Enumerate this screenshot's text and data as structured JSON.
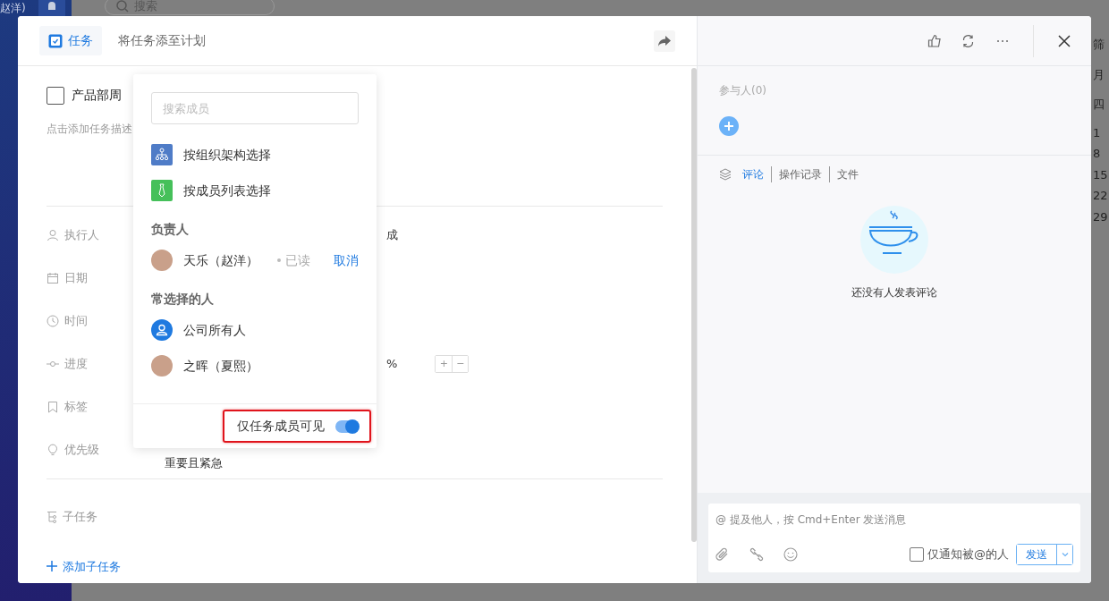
{
  "backdrop": {
    "user_name": "赵洋)",
    "search_placeholder": "搜索",
    "calendar_texts": [
      "筛",
      "月",
      "四",
      "1",
      "8",
      "15",
      "22",
      "29"
    ]
  },
  "task_panel": {
    "tabs": [
      {
        "label": "任务",
        "selected": true
      },
      {
        "label": "将任务添至计划",
        "selected": false
      }
    ],
    "task_title": "产品部周",
    "task_done": false,
    "description_placeholder": "点击添加任务描述",
    "fields": [
      {
        "kind": "person",
        "label": "执行人",
        "value": "成"
      },
      {
        "kind": "date",
        "label": "日期"
      },
      {
        "kind": "time",
        "label": "时间"
      },
      {
        "kind": "progress",
        "label": "进度",
        "value": "%",
        "stepper": [
          "+",
          "−"
        ]
      },
      {
        "kind": "tag",
        "label": "标签"
      },
      {
        "kind": "priority",
        "label": "优先级",
        "value": "重要且紧急"
      }
    ],
    "subtask_label": "子任务",
    "add_subtask": "添加子任务"
  },
  "member_picker": {
    "search_placeholder": "搜索成员",
    "options": [
      {
        "kind": "org",
        "label": "按组织架构选择"
      },
      {
        "kind": "list",
        "label": "按成员列表选择"
      }
    ],
    "sections": [
      {
        "title": "负责人",
        "people": [
          {
            "kind": "photo",
            "name": "天乐（赵洋）",
            "status": "已读",
            "action": "取消"
          }
        ]
      },
      {
        "title": "常选择的人",
        "people": [
          {
            "kind": "everyone",
            "name": "公司所有人"
          },
          {
            "kind": "photo",
            "name": "之晖（夏熙）"
          }
        ]
      }
    ],
    "visibility": {
      "label": "仅任务成员可见",
      "on": true,
      "highlighted": true
    }
  },
  "detail_panel": {
    "participants_label": "参与人(0)",
    "tabs": [
      {
        "label": "评论",
        "selected": true
      },
      {
        "label": "操作记录",
        "selected": false
      },
      {
        "label": "文件",
        "selected": false
      }
    ],
    "empty_message": "还没有人发表评论",
    "composer": {
      "placeholder": "@ 提及他人，按 Cmd+Enter 发送消息",
      "notify_only_mentioned": {
        "label": "仅通知被@的人",
        "checked": false
      },
      "send": "发送"
    }
  }
}
